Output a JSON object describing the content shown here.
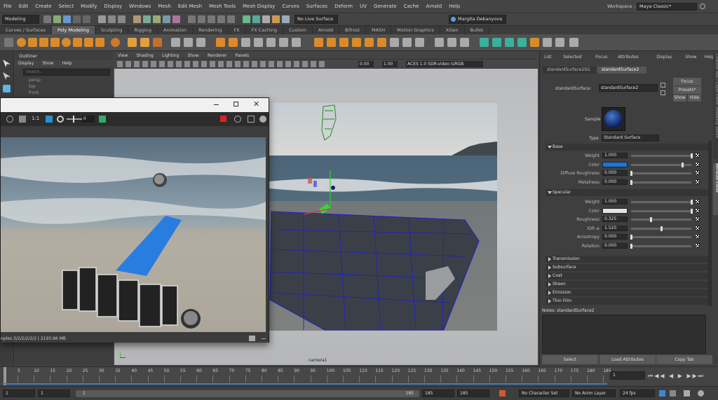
{
  "menubar": {
    "items": [
      "File",
      "Edit",
      "Create",
      "Select",
      "Modify",
      "Display",
      "Windows",
      "Mesh",
      "Edit Mesh",
      "Mesh Tools",
      "Mesh Display",
      "Curves",
      "Surfaces",
      "Deform",
      "UV",
      "Generate",
      "Cache",
      "Arnold",
      "Help"
    ],
    "workspace_label": "Workspace :",
    "workspace_value": "Maya Classic*"
  },
  "statusline": {
    "mode": "Modeling",
    "live_surface": "No Live Surface",
    "user": "Margita Dekanyova"
  },
  "shelf_tabs": [
    "Curves / Surfaces",
    "Poly Modeling",
    "Sculpting",
    "Rigging",
    "Animation",
    "Rendering",
    "FX",
    "FX Caching",
    "Custom",
    "Arnold",
    "Bifrost",
    "MASH",
    "Motion Graphics",
    "XGen",
    "Bullet"
  ],
  "shelf_active": "Poly Modeling",
  "outliner": {
    "title": "Outliner",
    "menu": [
      "Display",
      "Show",
      "Help"
    ],
    "search_placeholder": "Search...",
    "items": [
      "persp",
      "top",
      "front"
    ]
  },
  "viewport": {
    "menu": [
      "View",
      "Shading",
      "Lighting",
      "Show",
      "Renderer",
      "Panels"
    ],
    "val1": "0.00",
    "val2": "1.00",
    "colorspace": "ACES 1.0 SDR-video (sRGB",
    "camera": "camera1"
  },
  "render_window": {
    "ratio": "1:1",
    "frame": "0",
    "status": "nples 3/2/2/2/2/2 | 2193.96 MB"
  },
  "ae": {
    "menu": [
      "List",
      "Selected",
      "Focus",
      "Attributes",
      "Display",
      "Show",
      "Help"
    ],
    "tabs": [
      "standardSurface2SG",
      "standardSurface2"
    ],
    "node_label": "standardSurface:",
    "node_name": "standardSurface2",
    "focus": "Focus",
    "presets": "Presets*",
    "show": "Show",
    "hide": "Hide",
    "sample": "Sample",
    "type_label": "Type",
    "type_value": "Standard Surface",
    "base_title": "Base",
    "base_rows": [
      {
        "label": "Weight",
        "value": "1.000",
        "level": 1
      },
      {
        "label": "Color",
        "value": "",
        "level": 0.85,
        "swatch": "#1e73d6"
      },
      {
        "label": "Diffuse Roughness",
        "value": "0.000",
        "level": 0
      },
      {
        "label": "Metalness",
        "value": "0.000",
        "level": 0
      }
    ],
    "specular_title": "Specular",
    "spec_rows": [
      {
        "label": "Weight",
        "value": "1.000",
        "level": 1
      },
      {
        "label": "Color",
        "value": "",
        "level": 1,
        "swatch": "#e6e6e6"
      },
      {
        "label": "Roughness",
        "value": "0.325",
        "level": 0.325
      },
      {
        "label": "IOR",
        "value": "1.520",
        "level": 0.5
      },
      {
        "label": "Anisotropy",
        "value": "0.000",
        "level": 0
      },
      {
        "label": "Rotation",
        "value": "0.000",
        "level": 0
      }
    ],
    "collapsed": [
      "Transmission",
      "Subsurface",
      "Coat",
      "Sheen",
      "Emission",
      "Thin Film"
    ],
    "notes": "Notes: standardSurface2",
    "buttons": [
      "Select",
      "Load Attributes",
      "Copy Tab"
    ],
    "side_tabs": [
      "Channel Box / Layer Editor",
      "Modeling Toolkit",
      "Attribute Editor"
    ]
  },
  "timeline": {
    "ticks": [
      "5",
      "10",
      "15",
      "20",
      "25",
      "30",
      "35",
      "40",
      "45",
      "50",
      "55",
      "60",
      "65",
      "70",
      "75",
      "80",
      "85",
      "90",
      "95",
      "100",
      "105",
      "110",
      "115",
      "120",
      "125",
      "130",
      "135",
      "140",
      "145",
      "150",
      "155",
      "160",
      "165",
      "170",
      "175",
      "180",
      "185"
    ],
    "current": "1"
  },
  "rangebar": {
    "start": "1",
    "start2": "1",
    "range_start": "1",
    "range_end": "185",
    "end1": "185",
    "end2": "185",
    "char_set": "No Character Set",
    "anim_layer": "No Anim Layer",
    "fps": "24 fps"
  }
}
